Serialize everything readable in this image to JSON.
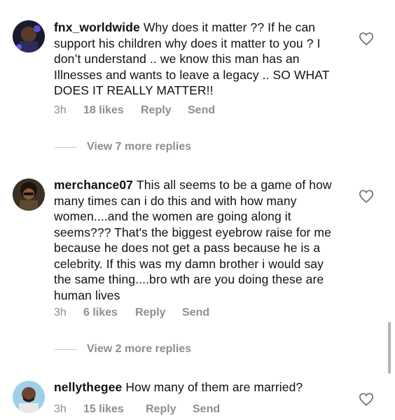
{
  "colors": {
    "text": "#111111",
    "muted": "#8e8e8e",
    "divider": "#c7c7c7"
  },
  "comments": [
    {
      "username": "fnx_worldwide",
      "text": "Why does it matter ?? If he can support his children why does it matter to you ? I don’t understand .. we know this man has an Illnesses and wants to leave a legacy .. SO WHAT DOES IT REALLY MATTER!!",
      "time": "3h",
      "likes": "18 likes",
      "reply": "Reply",
      "send": "Send",
      "view_more": "View 7 more replies",
      "heart_icon": "heart-outline-icon"
    },
    {
      "username": "merchance07",
      "text": "This all seems to be a game of how many times can i do this and with how many women....and the women are going along it seems??? That's the biggest eyebrow raise for me because he does not get a pass because he is a celebrity. If this was my damn brother i would say the same thing....bro wth are you doing these are human lives",
      "time": "3h",
      "likes": "6 likes",
      "reply": "Reply",
      "send": "Send",
      "view_more": "View 2 more replies",
      "heart_icon": "heart-outline-icon"
    },
    {
      "username": "nellythegee",
      "text": "How many of them are married?",
      "time": "3h",
      "likes": "15 likes",
      "reply": "Reply",
      "send": "Send",
      "heart_icon": "heart-outline-icon"
    }
  ]
}
